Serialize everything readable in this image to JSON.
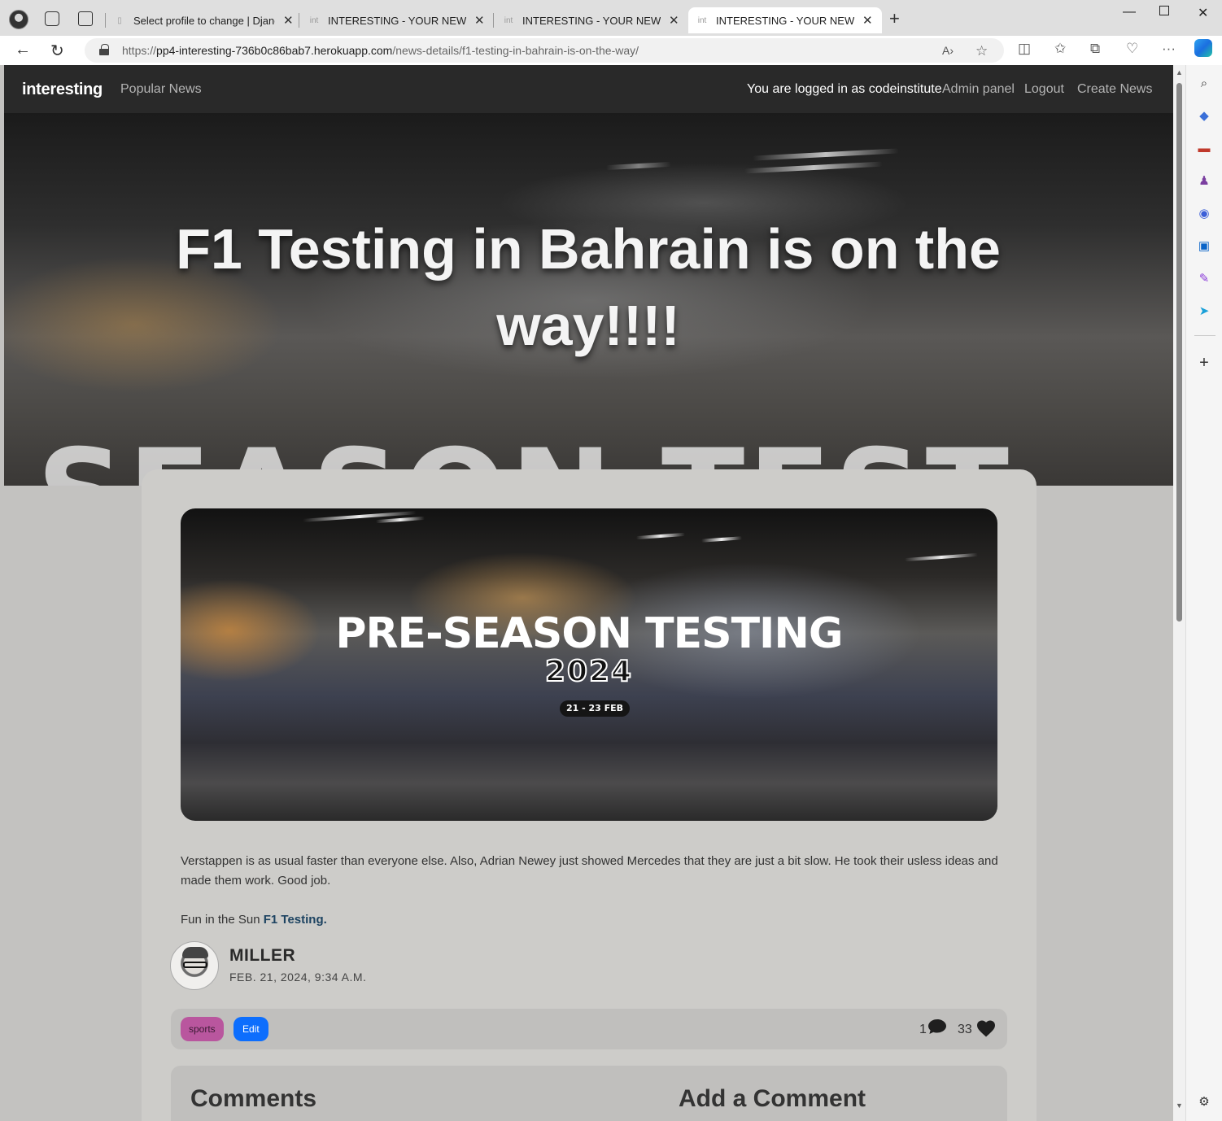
{
  "browser": {
    "tabs": [
      {
        "title": "Select profile to change | Django"
      },
      {
        "title": "INTERESTING - YOUR NEWS FIX"
      },
      {
        "title": "INTERESTING - YOUR NEWS FIX"
      },
      {
        "title": "INTERESTING - YOUR NEWS FIX",
        "active": true
      }
    ],
    "url_prefix": "https://",
    "url_host": "pp4-interesting-736b0c86bab7.herokuapp.com",
    "url_path": "/news-details/f1-testing-in-bahrain-is-on-the-way/"
  },
  "nav": {
    "brand": "interesting",
    "popular": "Popular News",
    "logged_in": "You are logged in as codeinstitute",
    "admin": "Admin panel",
    "logout": "Logout",
    "create": "Create News"
  },
  "hero": {
    "title": "F1 Testing in Bahrain is on the way!!!!",
    "bg_text": "SEASON TEST"
  },
  "image": {
    "headline": "PRE-SEASON TESTING",
    "year": "2024",
    "date": "21 - 23 FEB"
  },
  "article": {
    "body": "Verstappen is as usual faster than everyone else. Also, Adrian Newey just showed Mercedes that they are just a bit slow. He took their usless ideas and made them work. Good job.",
    "line2_prefix": "Fun in the Sun ",
    "line2_link": "F1 Testing.",
    "author": "MILLER",
    "date": "FEB. 21, 2024, 9:34 A.M.",
    "category": "sports",
    "edit": "Edit",
    "comment_count": "1",
    "like_count": "33"
  },
  "comments": {
    "heading": "Comments",
    "add_heading": "Add a Comment"
  },
  "colors": {
    "navbar": "#292929",
    "card": "#cdccc9",
    "badge": "#b9569e",
    "edit": "#0d6efd",
    "link": "#1d4361"
  }
}
